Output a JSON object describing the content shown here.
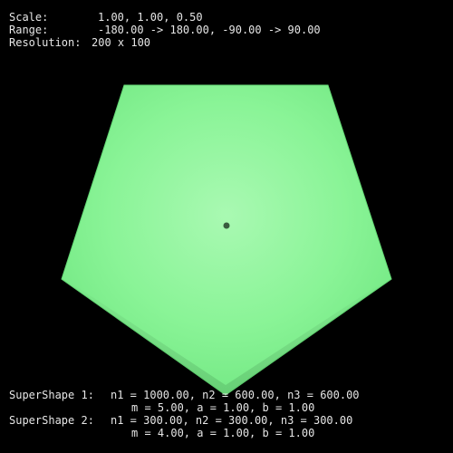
{
  "hud": {
    "scale": {
      "label": "Scale:",
      "value": "1.00, 1.00, 0.50"
    },
    "range": {
      "label": "Range:",
      "value": "-180.00 -> 180.00, -90.00 -> 90.00"
    },
    "resolution": {
      "label": "Resolution:",
      "value": "200 x 100"
    }
  },
  "supershapes": [
    {
      "label": "SuperShape 1:",
      "line1": "n1 = 1000.00, n2 = 600.00, n3 = 600.00",
      "line2": "m = 5.00, a = 1.00, b = 1.00"
    },
    {
      "label": "SuperShape 2:",
      "line1": "n1 = 300.00, n2 = 300.00, n3 = 300.00",
      "line2": "m = 4.00, a = 1.00, b = 1.00"
    }
  ],
  "render": {
    "background": "#000000",
    "shape_fill": "#7ff08e",
    "shape_highlight": "#a4f7ad",
    "shape_edge": "#5ccf6b",
    "center_marker": "#2f5236",
    "text_color": "#e6e6e6"
  }
}
